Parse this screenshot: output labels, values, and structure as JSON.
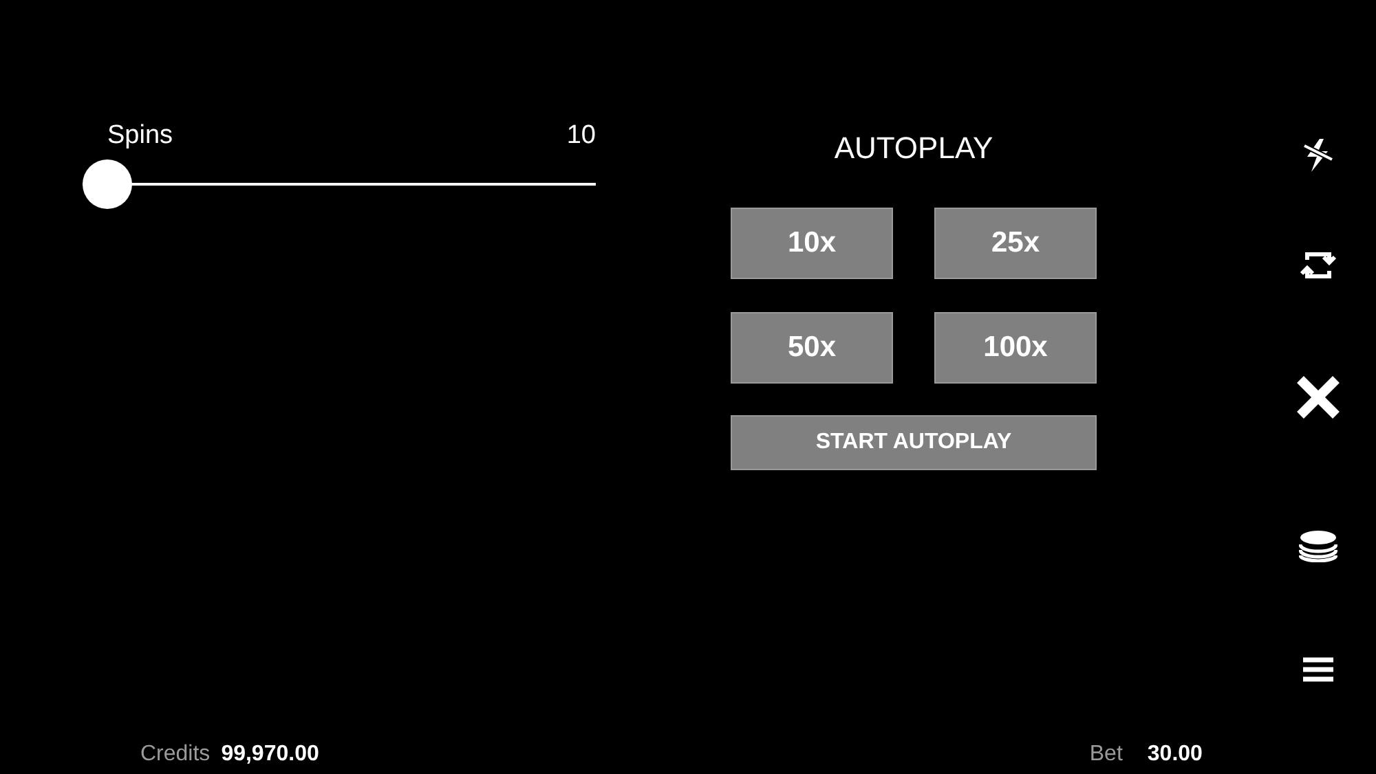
{
  "slider": {
    "label": "Spins",
    "reading": "10",
    "level": 0
  },
  "autoplay": {
    "title": "AUTOPLAY",
    "options": [
      {
        "label": "10x"
      },
      {
        "label": "25x"
      },
      {
        "label": "50x"
      },
      {
        "label": "100x"
      }
    ],
    "start": "START AUTOPLAY"
  },
  "sidebar": {
    "items": [
      {
        "kind": "turbo"
      },
      {
        "kind": "autoplay"
      },
      {
        "kind": "close"
      },
      {
        "kind": "coins"
      },
      {
        "kind": "menu"
      }
    ]
  },
  "status_bar": {
    "credits_label": "Credits",
    "credits": "99,970.00",
    "bet_label": "Bet",
    "bet": "30.00"
  }
}
